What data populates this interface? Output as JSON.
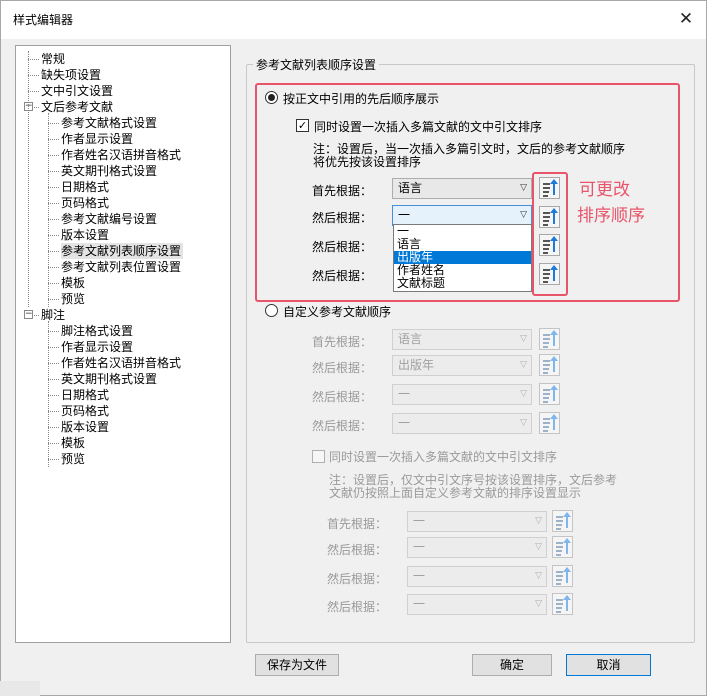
{
  "window": {
    "title": "样式编辑器",
    "close_icon": "close-icon"
  },
  "tree": {
    "items": [
      {
        "label": "常规"
      },
      {
        "label": "缺失项设置"
      },
      {
        "label": "文中引文设置"
      },
      {
        "label": "文后参考文献"
      },
      {
        "label": "参考文献格式设置"
      },
      {
        "label": "作者显示设置"
      },
      {
        "label": "作者姓名汉语拼音格式"
      },
      {
        "label": "英文期刊格式设置"
      },
      {
        "label": "日期格式"
      },
      {
        "label": "页码格式"
      },
      {
        "label": "参考文献编号设置"
      },
      {
        "label": "版本设置"
      },
      {
        "label": "参考文献列表顺序设置"
      },
      {
        "label": "参考文献列表位置设置"
      },
      {
        "label": "模板"
      },
      {
        "label": "预览"
      },
      {
        "label": "脚注"
      },
      {
        "label": "脚注格式设置"
      },
      {
        "label": "作者显示设置"
      },
      {
        "label": "作者姓名汉语拼音格式"
      },
      {
        "label": "英文期刊格式设置"
      },
      {
        "label": "日期格式"
      },
      {
        "label": "页码格式"
      },
      {
        "label": "版本设置"
      },
      {
        "label": "模板"
      },
      {
        "label": "预览"
      }
    ],
    "selected": "参考文献列表顺序设置"
  },
  "group": {
    "title": "参考文献列表顺序设置"
  },
  "opt1": {
    "label": "按正文中引用的先后顺序展示",
    "checked": true,
    "checkbox_label": "同时设置一次插入多篇文献的文中引文排序",
    "checkbox_checked": true,
    "note_line1": "注：设置后，当一次插入多篇引文时，文后的参考文献顺序",
    "note_line2": "将优先按该设置排序",
    "rows": [
      {
        "label": "首先根据：",
        "value": "语言"
      },
      {
        "label": "然后根据：",
        "value": "一"
      },
      {
        "label": "然后根据：",
        "value": ""
      },
      {
        "label": "然后根据：",
        "value": ""
      }
    ],
    "dropdown_options": [
      "一",
      "语言",
      "出版年",
      "作者姓名",
      "文献标题"
    ],
    "dropdown_highlighted": "出版年"
  },
  "annotation": {
    "line1": "可更改",
    "line2": "排序顺序",
    "color": "#e8556a"
  },
  "opt2": {
    "label": "自定义参考文献顺序",
    "checked": false,
    "rows": [
      {
        "label": "首先根据：",
        "value": "语言"
      },
      {
        "label": "然后根据：",
        "value": "出版年"
      },
      {
        "label": "然后根据：",
        "value": "一"
      },
      {
        "label": "然后根据：",
        "value": "一"
      }
    ],
    "checkbox_label": "同时设置一次插入多篇文献的文中引文排序",
    "checkbox_checked": false,
    "note_line1": "注：设置后，仅文中引文序号按该设置排序，文后参考",
    "note_line2": "文献仍按照上面自定义参考文献的排序设置显示",
    "rows2": [
      {
        "label": "首先根据：",
        "value": "一"
      },
      {
        "label": "然后根据：",
        "value": "一"
      },
      {
        "label": "然后根据：",
        "value": "一"
      },
      {
        "label": "然后根据：",
        "value": "一"
      }
    ]
  },
  "buttons": {
    "save_as_file": "保存为文件",
    "ok": "确定",
    "cancel": "取消"
  },
  "icons": {
    "sort": "sort-ascending-icon",
    "expand": "expand-minus-icon"
  }
}
